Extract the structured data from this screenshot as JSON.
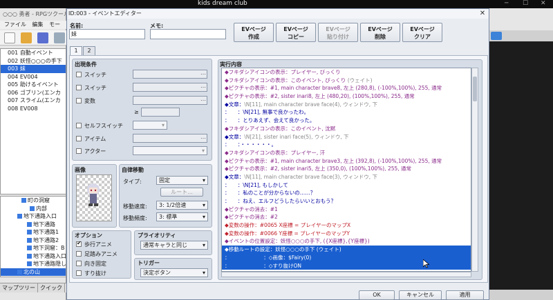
{
  "topbar": {
    "title": "kids dream club"
  },
  "main": {
    "window_title": "○○○ 勇者 - RPGツクール",
    "menu": [
      "ファイル",
      "編集",
      "モー"
    ],
    "event_list": [
      "001 自動イベント",
      "002 妖怪○○○の手下",
      "003 妹",
      "004 EV004",
      "005 助けるイベント",
      "006 ゴブリン(エンカ",
      "007 スライム(エンカ",
      "008 EV008"
    ],
    "selected_event_index": 2,
    "map_tree": [
      "町の洞窟",
      "内部",
      "地下通路入口",
      "地下通路",
      "地下通路1",
      "地下通路2",
      "地下洞窟：B",
      "地下通路入口",
      "地下通路隠し",
      "北の山"
    ],
    "selected_map": "北の山",
    "bottom_tabs": [
      "マップツリー",
      "クイック"
    ]
  },
  "dialog": {
    "title": "ID:003 - イベントエディター",
    "name_label": "名前:",
    "name_value": "妹",
    "memo_label": "メモ:",
    "memo_value": "",
    "buttons": [
      {
        "label1": "EVページ",
        "label2": "作成",
        "enabled": true
      },
      {
        "label1": "EVページ",
        "label2": "コピー",
        "enabled": true
      },
      {
        "label1": "EVページ",
        "label2": "貼り付け",
        "enabled": false
      },
      {
        "label1": "EVページ",
        "label2": "削除",
        "enabled": true
      },
      {
        "label1": "EVページ",
        "label2": "クリア",
        "enabled": true
      }
    ],
    "page_tabs": [
      "1",
      "2"
    ],
    "conditions_label": "出現条件",
    "conditions": [
      "スイッチ",
      "スイッチ",
      "変数",
      "セルフスイッチ",
      "アイテム",
      "アクター"
    ],
    "compare_sym": "≥",
    "image_label": "画像",
    "autonomous_label": "自律移動",
    "type_label": "タイプ:",
    "type_value": "固定",
    "route_button": "ルート...",
    "speed_label": "移動速度:",
    "speed_value": "3: 1/2倍速",
    "freq_label": "移動頻度:",
    "freq_value": "3: 標準",
    "options_label": "オプション",
    "options": [
      {
        "label": "歩行アニメ",
        "checked": true
      },
      {
        "label": "足踏みアニメ",
        "checked": false
      },
      {
        "label": "向き固定",
        "checked": false
      },
      {
        "label": "すり抜け",
        "checked": false
      }
    ],
    "priority_label": "プライオリティ",
    "priority_value": "通常キャラと同じ",
    "trigger_label": "トリガー",
    "trigger_value": "決定ボタン",
    "contents_label": "実行内容",
    "ok": "OK",
    "cancel": "キャンセル",
    "apply": "適用"
  },
  "commands": [
    {
      "text": "◆フキダシアイコンの表示：プレイヤー, びっくり",
      "color": "purple",
      "sel": false
    },
    {
      "text": "◆フキダシアイコンの表示：このイベント, びっくり",
      "tail": " (ウェイト)",
      "color": "purple",
      "sel": false
    },
    {
      "text": "◆ピクチャの表示：#1, main character brave8, 左上 (280,8), (-100%,100%), 255, 通常",
      "color": "purple",
      "sel": false
    },
    {
      "text": "◆ピクチャの表示：#2, sister inari8, 左上 (480,20), (100%,100%), 255, 通常",
      "color": "purple",
      "sel": false
    },
    {
      "text": "◆文章：",
      "tail": "\\N[11], main character brave face(4), ウィンドウ, 下",
      "color": "blue",
      "sel": false
    },
    {
      "text": "：　　：\\N[21], 無事で良かったわ。",
      "color": "blue",
      "sel": false
    },
    {
      "text": "：　　：とりあえず、会えて良かった。",
      "color": "blue",
      "sel": false
    },
    {
      "text": "◆フキダシアイコンの表示：このイベント, 沈黙",
      "color": "purple",
      "sel": false
    },
    {
      "text": "◆文章：",
      "tail": "\\N[21], sister inari face(5), ウィンドウ, 下",
      "color": "blue",
      "sel": false
    },
    {
      "text": "：　　：・・・・・・。",
      "color": "blue",
      "sel": false
    },
    {
      "text": "◆フキダシアイコンの表示：プレイヤー, 汗",
      "color": "purple",
      "sel": false
    },
    {
      "text": "◆ピクチャの表示：#1, main character brave3, 左上 (392,8), (-100%,100%), 255, 通常",
      "color": "purple",
      "sel": false
    },
    {
      "text": "◆ピクチャの表示：#2, sister inari5, 左上 (350,0), (100%,100%), 255, 通常",
      "color": "purple",
      "sel": false
    },
    {
      "text": "◆文章：",
      "tail": "\\N[11], main character brave face(3), ウィンドウ, 下",
      "color": "blue",
      "sel": false
    },
    {
      "text": "：　　：\\N[21], もしかして",
      "color": "blue",
      "sel": false
    },
    {
      "text": "：　　：私のことが分からないの……？",
      "color": "blue",
      "sel": false
    },
    {
      "text": "：　　：ねえ、エルフどうしたらいいとおもう？",
      "color": "blue",
      "sel": false
    },
    {
      "text": "◆ピクチャの消去：#1",
      "color": "purple",
      "sel": false
    },
    {
      "text": "◆ピクチャの消去：#2",
      "color": "purple",
      "sel": false
    },
    {
      "text": "◆変数の操作：#0065 X座標 = プレイヤーのマップX",
      "color": "red",
      "sel": false
    },
    {
      "text": "◆変数の操作：#0066 Y座標 = プレイヤーのマップY",
      "color": "red",
      "sel": false
    },
    {
      "text": "◆イベントの位置設定：妖怪○○○の手下, ({X座標},{Y座標})",
      "color": "purple",
      "sel": false
    },
    {
      "text": "◆移動ルートの設定：妖怪○○○の手下 (ウェイト)",
      "color": "black",
      "sel": true
    },
    {
      "text": "：　　　　　　　：◇画像：$Fairy(0)",
      "color": "black",
      "sel": true
    },
    {
      "text": "：　　　　　　　：◇すり抜けON",
      "color": "black",
      "sel": true
    }
  ],
  "colors": {
    "selection": "#1a5fd0",
    "purple": "#8a2a8a",
    "red": "#c0202a",
    "blue": "#0000a0"
  }
}
